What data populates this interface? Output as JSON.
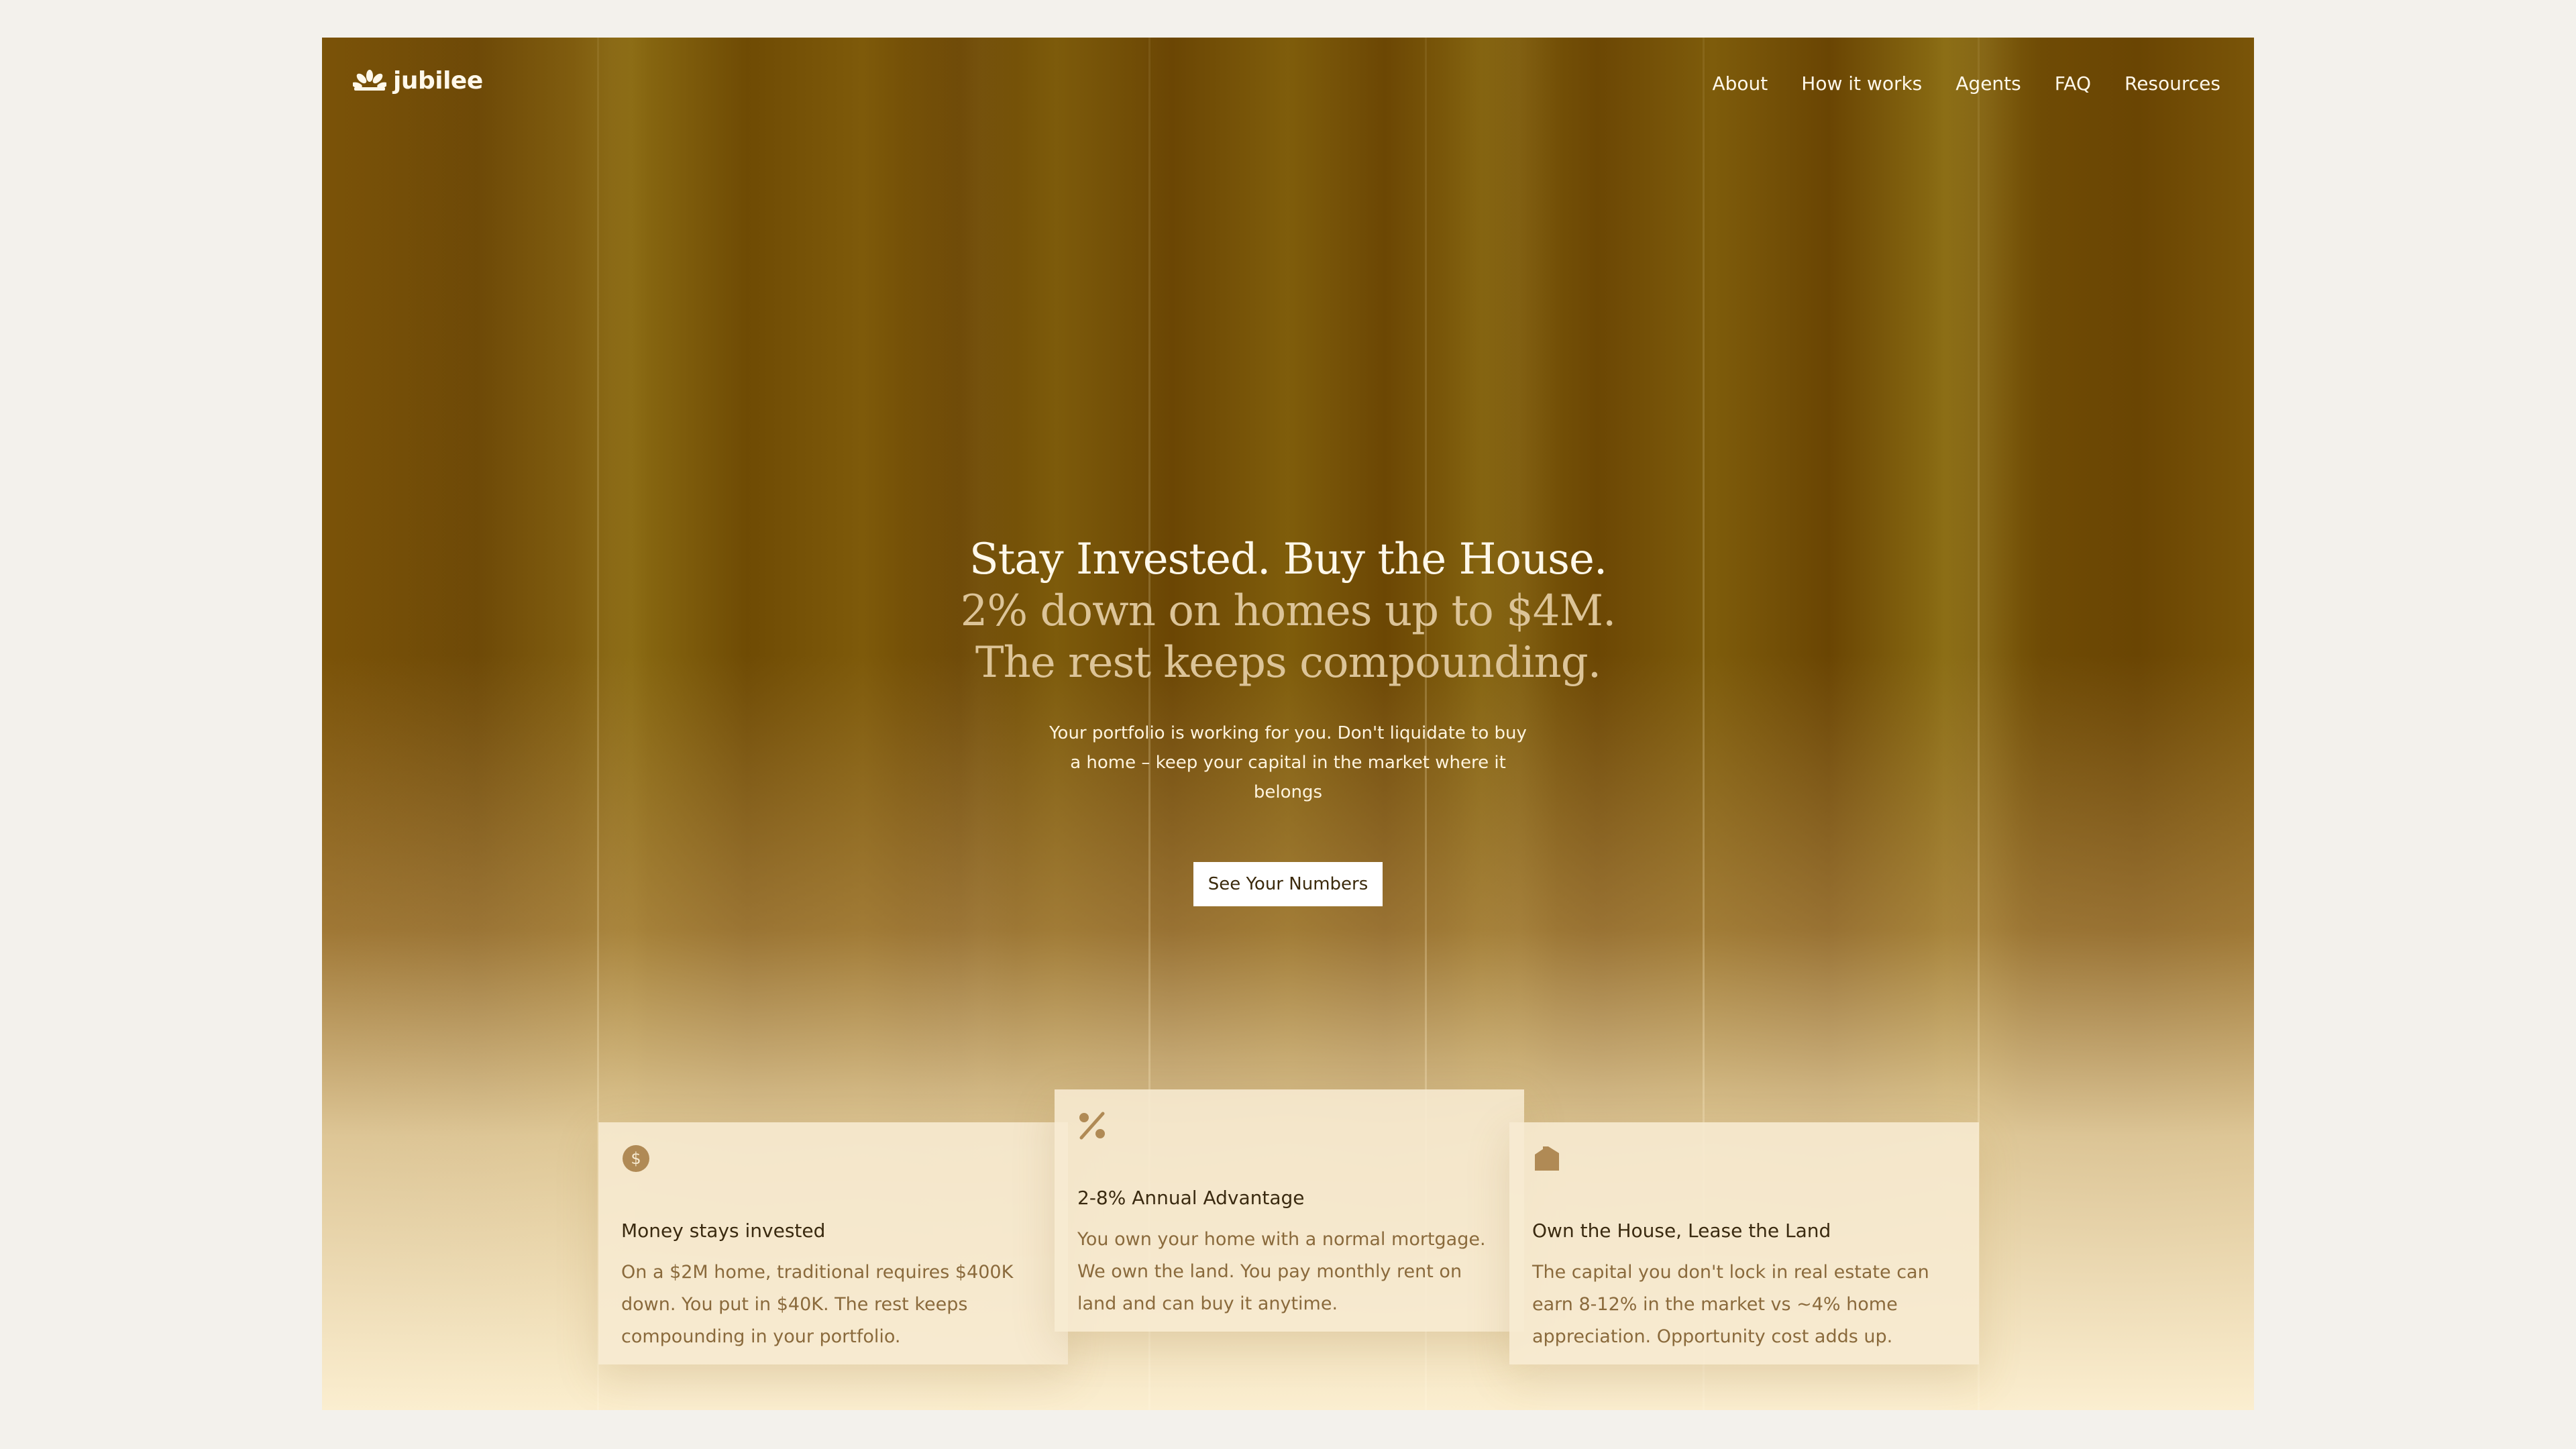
{
  "brand": {
    "logo_text": "jubilee",
    "accent": "#6a4503",
    "card_icon_color": "#b08a55"
  },
  "nav": {
    "items": [
      {
        "label": "About"
      },
      {
        "label": "How it works"
      },
      {
        "label": "Agents"
      },
      {
        "label": "FAQ"
      },
      {
        "label": "Resources"
      }
    ]
  },
  "hero": {
    "line1": "Stay Invested. Buy the House.",
    "line2": "2% down on homes up to $4M.",
    "line3": "The rest keeps compounding.",
    "subtitle": "Your portfolio is working for you. Don't liquidate to buy a home – keep your capital in the market where it belongs",
    "cta_label": "See Your Numbers"
  },
  "cards": [
    {
      "icon": "dollar-coin-icon",
      "title": "Money stays invested",
      "body": "On a $2M home, traditional requires $400K down. You put in $40K. The rest keeps compounding in your portfolio."
    },
    {
      "icon": "percent-icon",
      "title": "2-8% Annual Advantage",
      "body": "You own your home with a normal mortgage. We own the land. You pay monthly rent on land and can buy it anytime."
    },
    {
      "icon": "house-icon",
      "title": "Own the House, Lease the Land",
      "body": "The capital you don't lock in real estate can earn 8-12% in the market vs ~4% home appreciation. Opportunity cost adds up."
    }
  ]
}
